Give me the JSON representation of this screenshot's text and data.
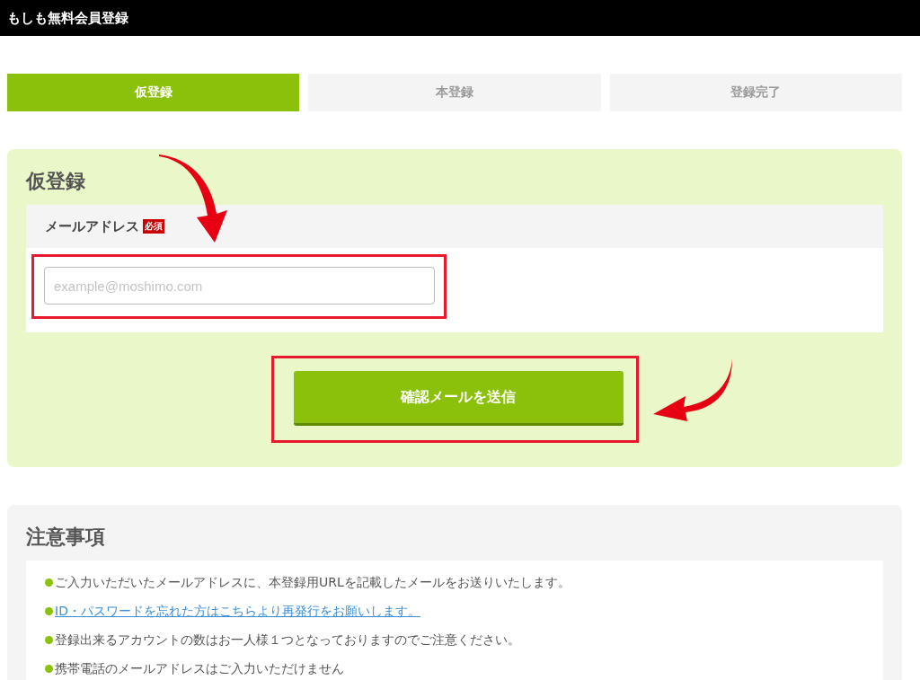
{
  "header": {
    "title": "もしも無料会員登録"
  },
  "steps": [
    {
      "label": "仮登録",
      "selected": true
    },
    {
      "label": "本登録",
      "selected": false
    },
    {
      "label": "登録完了",
      "selected": false
    }
  ],
  "registration": {
    "heading": "仮登録",
    "field_label": "メールアドレス",
    "required_badge": "必須",
    "email": {
      "placeholder": "example@moshimo.com"
    },
    "submit_button": "確認メールを送信"
  },
  "notes": {
    "heading": "注意事項",
    "items": [
      {
        "kind": "text",
        "text": "ご入力いただいたメールアドレスに、本登録用URLを記載したメールをお送りいたします。"
      },
      {
        "kind": "link",
        "text": "ID・パスワードを忘れた方はこちらより再発行をお願いします。"
      },
      {
        "kind": "text",
        "text": "登録出来るアカウントの数はお一人様１つとなっておりますのでご注意ください。"
      },
      {
        "kind": "text",
        "text": "携帯電話のメールアドレスはご入力いただけません"
      }
    ]
  }
}
